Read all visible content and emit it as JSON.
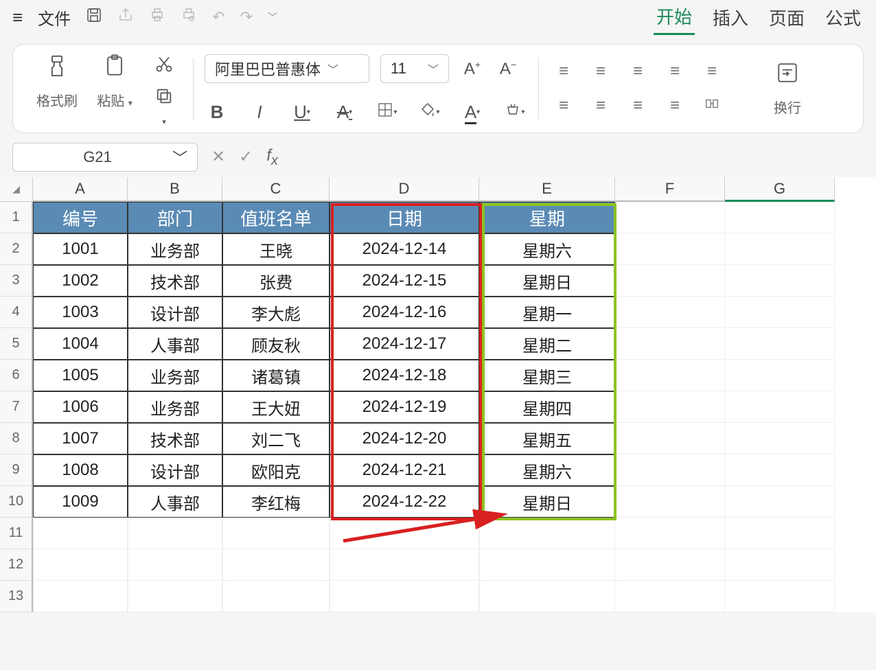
{
  "menu": {
    "file": "文件",
    "tabs": [
      "开始",
      "插入",
      "页面",
      "公式"
    ],
    "active_tab": 0
  },
  "ribbon": {
    "format_painter": "格式刷",
    "paste": "粘贴",
    "wrap": "换行",
    "font_name": "阿里巴巴普惠体",
    "font_size": "11"
  },
  "formula_bar": {
    "cell_ref": "G21",
    "formula": ""
  },
  "columns": [
    "A",
    "B",
    "C",
    "D",
    "E",
    "F",
    "G"
  ],
  "selected_column_index": 6,
  "row_numbers": [
    1,
    2,
    3,
    4,
    5,
    6,
    7,
    8,
    9,
    10,
    11,
    12,
    13
  ],
  "headers": [
    "编号",
    "部门",
    "值班名单",
    "日期",
    "星期"
  ],
  "rows": [
    {
      "id": "1001",
      "dept": "业务部",
      "name": "王晓",
      "date": "2024-12-14",
      "wd": "星期六"
    },
    {
      "id": "1002",
      "dept": "技术部",
      "name": "张费",
      "date": "2024-12-15",
      "wd": "星期日"
    },
    {
      "id": "1003",
      "dept": "设计部",
      "name": "李大彪",
      "date": "2024-12-16",
      "wd": "星期一"
    },
    {
      "id": "1004",
      "dept": "人事部",
      "name": "顾友秋",
      "date": "2024-12-17",
      "wd": "星期二"
    },
    {
      "id": "1005",
      "dept": "业务部",
      "name": "诸葛镇",
      "date": "2024-12-18",
      "wd": "星期三"
    },
    {
      "id": "1006",
      "dept": "业务部",
      "name": "王大妞",
      "date": "2024-12-19",
      "wd": "星期四"
    },
    {
      "id": "1007",
      "dept": "技术部",
      "name": "刘二飞",
      "date": "2024-12-20",
      "wd": "星期五"
    },
    {
      "id": "1008",
      "dept": "设计部",
      "name": "欧阳克",
      "date": "2024-12-21",
      "wd": "星期六"
    },
    {
      "id": "1009",
      "dept": "人事部",
      "name": "李红梅",
      "date": "2024-12-22",
      "wd": "星期日"
    }
  ]
}
